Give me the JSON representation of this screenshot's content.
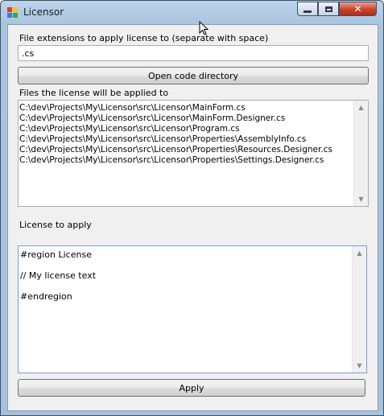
{
  "window": {
    "title": "Licensor"
  },
  "extensions": {
    "label": "File extensions to apply license to (separate with space)",
    "value": ".cs"
  },
  "open_button": {
    "label": "Open code directory"
  },
  "files": {
    "label": "Files the license will be applied to",
    "items": [
      "C:\\dev\\Projects\\My\\Licensor\\src\\Licensor\\MainForm.cs",
      "C:\\dev\\Projects\\My\\Licensor\\src\\Licensor\\MainForm.Designer.cs",
      "C:\\dev\\Projects\\My\\Licensor\\src\\Licensor\\Program.cs",
      "C:\\dev\\Projects\\My\\Licensor\\src\\Licensor\\Properties\\AssemblyInfo.cs",
      "C:\\dev\\Projects\\My\\Licensor\\src\\Licensor\\Properties\\Resources.Designer.cs",
      "C:\\dev\\Projects\\My\\Licensor\\src\\Licensor\\Properties\\Settings.Designer.cs"
    ]
  },
  "license": {
    "label": "License to apply",
    "lines": [
      "#region License",
      "",
      "// My license text",
      "",
      "#endregion"
    ]
  },
  "apply_button": {
    "label": "Apply"
  },
  "icons": [
    "app-icon",
    "minimize-icon",
    "maximize-icon",
    "close-icon",
    "scroll-up-icon",
    "scroll-down-icon"
  ],
  "colors": {
    "title_bar": "#a9c4e1",
    "close_button": "#c7442b",
    "form_background": "#f0f0f0"
  }
}
